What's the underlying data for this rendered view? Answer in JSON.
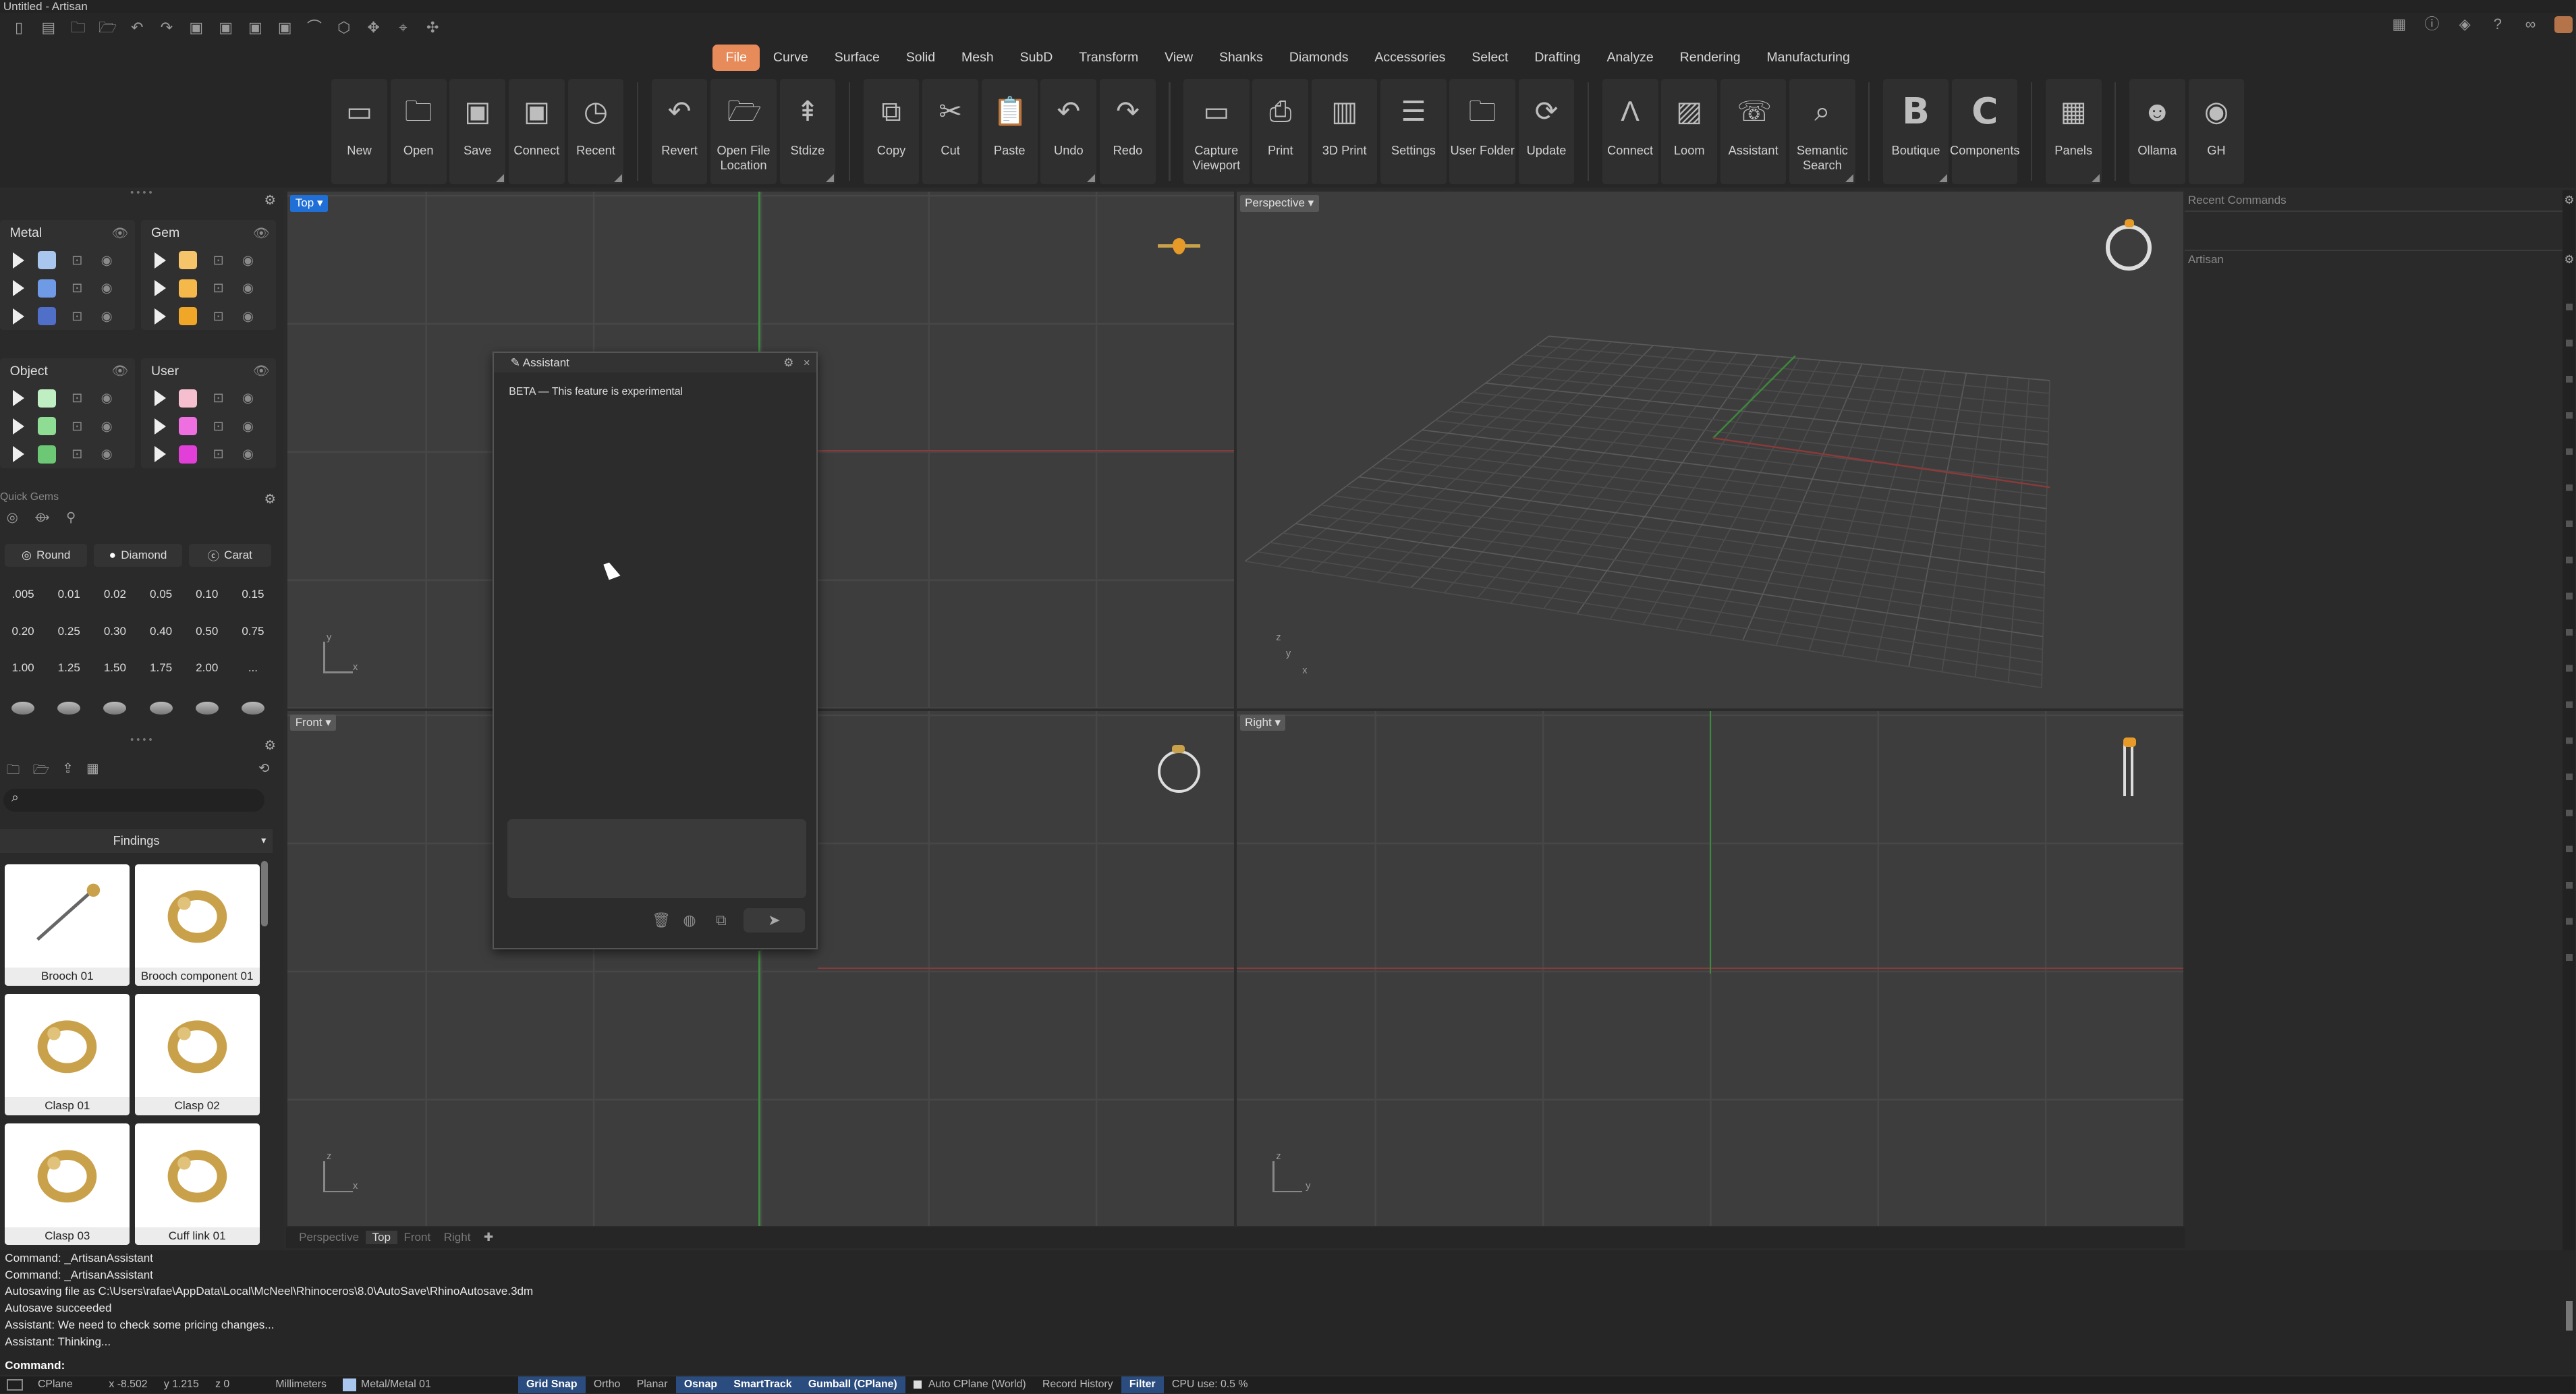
{
  "window": {
    "title": "Untitled - Artisan"
  },
  "menu": {
    "tabs": [
      "File",
      "Curve",
      "Surface",
      "Solid",
      "Mesh",
      "SubD",
      "Transform",
      "View",
      "Shanks",
      "Diamonds",
      "Accessories",
      "Select",
      "Drafting",
      "Analyze",
      "Rendering",
      "Manufacturing"
    ],
    "active": "File"
  },
  "ribbon": {
    "groups": [
      [
        {
          "label": "New",
          "icon": "new-doc-icon",
          "glyph": "▭"
        },
        {
          "label": "Open",
          "icon": "folder-icon",
          "glyph": "🗀"
        },
        {
          "label": "Save",
          "icon": "save-icon",
          "glyph": "▣"
        },
        {
          "label": "Connect",
          "icon": "connect-save-icon",
          "glyph": "▣"
        },
        {
          "label": "Recent",
          "icon": "recent-icon",
          "glyph": "◷"
        }
      ],
      [
        {
          "label": "Revert",
          "icon": "revert-icon",
          "glyph": "↶"
        },
        {
          "label": "Open File Location",
          "icon": "folder-open-icon",
          "glyph": "🗁"
        },
        {
          "label": "Stdize",
          "icon": "standardize-icon",
          "glyph": "⇞"
        }
      ],
      [
        {
          "label": "Copy",
          "icon": "copy-icon",
          "glyph": "⧉"
        },
        {
          "label": "Cut",
          "icon": "scissors-icon",
          "glyph": "✂"
        },
        {
          "label": "Paste",
          "icon": "paste-icon",
          "glyph": "📋"
        },
        {
          "label": "Undo",
          "icon": "undo-icon",
          "glyph": "↶"
        },
        {
          "label": "Redo",
          "icon": "redo-icon",
          "glyph": "↷"
        }
      ],
      [
        {
          "label": "Capture Viewport",
          "icon": "monitor-icon",
          "glyph": "▭"
        },
        {
          "label": "Print",
          "icon": "printer-icon",
          "glyph": "⎙"
        },
        {
          "label": "3D Print",
          "icon": "3d-printer-icon",
          "glyph": "▥"
        },
        {
          "label": "Settings",
          "icon": "settings-doc-icon",
          "glyph": "☰"
        },
        {
          "label": "User Folder",
          "icon": "user-folder-icon",
          "glyph": "🗀"
        },
        {
          "label": "Update",
          "icon": "refresh-icon",
          "glyph": "⟳"
        }
      ],
      [
        {
          "label": "Connect",
          "icon": "artisan-a-icon",
          "glyph": "Λ"
        },
        {
          "label": "Loom",
          "icon": "image-icon",
          "glyph": "▨"
        },
        {
          "label": "Assistant",
          "icon": "chat-icon",
          "glyph": "☏"
        },
        {
          "label": "Semantic Search",
          "icon": "sparkle-search-icon",
          "glyph": "⌕"
        }
      ],
      [
        {
          "label": "Boutique",
          "icon": "boutique-b-icon",
          "glyph": "B"
        },
        {
          "label": "Components",
          "icon": "components-c-icon",
          "glyph": "C"
        }
      ],
      [
        {
          "label": "Panels",
          "icon": "panels-icon",
          "glyph": "▦"
        }
      ],
      [
        {
          "label": "Ollama",
          "icon": "ollama-icon",
          "glyph": "☻"
        },
        {
          "label": "GH",
          "icon": "grasshopper-icon",
          "glyph": "◉"
        }
      ]
    ]
  },
  "layers": {
    "metal": {
      "title": "Metal",
      "colors": [
        "#a9c6ef",
        "#6f9ae6",
        "#4f6fc8"
      ]
    },
    "gem": {
      "title": "Gem",
      "colors": [
        "#f6c56a",
        "#f5b84a",
        "#f0a626"
      ]
    },
    "object": {
      "title": "Object",
      "colors": [
        "#bfeec3",
        "#8fdc95",
        "#6cc874"
      ]
    },
    "user": {
      "title": "User",
      "colors": [
        "#f6bfd0",
        "#ee6fe0",
        "#e23ed8"
      ]
    }
  },
  "quickgems": {
    "title": "Quick Gems",
    "cut": "Round",
    "material": "Diamond",
    "unit": "Carat",
    "sizes": [
      ".005",
      "0.01",
      "0.02",
      "0.05",
      "0.10",
      "0.15",
      "0.20",
      "0.25",
      "0.30",
      "0.40",
      "0.50",
      "0.75",
      "1.00",
      "1.25",
      "1.50",
      "1.75",
      "2.00",
      "..."
    ]
  },
  "library": {
    "category": "Findings",
    "items": [
      "Brooch 01",
      "Brooch component 01",
      "Clasp 01",
      "Clasp 02",
      "Clasp 03",
      "Cuff link 01"
    ]
  },
  "viewports": {
    "top": "Top",
    "perspective": "Perspective",
    "front": "Front",
    "right": "Right",
    "tabs": [
      "Perspective",
      "Top",
      "Front",
      "Right"
    ],
    "active_tab": "Top"
  },
  "assistant": {
    "title": "Assistant",
    "beta": "BETA — This feature is experimental"
  },
  "right_panel": {
    "recent": "Recent Commands",
    "artisan": "Artisan"
  },
  "command_history": [
    "Command: _ArtisanAssistant",
    "Command: _ArtisanAssistant",
    "Autosaving file as C:\\Users\\rafae\\AppData\\Local\\McNeel\\Rhinoceros\\8.0\\AutoSave\\RhinoAutosave.3dm",
    "Autosave succeeded",
    "Assistant: We need to check some pricing changes...",
    "Assistant: Thinking..."
  ],
  "command_prompt": "Command:",
  "status": {
    "cplane": "CPlane",
    "x": "x -8.502",
    "y": "y 1.215",
    "z": "z 0",
    "units": "Millimeters",
    "layer": "Metal/Metal 01",
    "grid_snap": "Grid Snap",
    "ortho": "Ortho",
    "planar": "Planar",
    "osnap": "Osnap",
    "smarttrack": "SmartTrack",
    "gumball": "Gumball (CPlane)",
    "autocplane": "Auto CPlane (World)",
    "record": "Record History",
    "filter": "Filter",
    "cpu": "CPU use: 0.5 %"
  }
}
